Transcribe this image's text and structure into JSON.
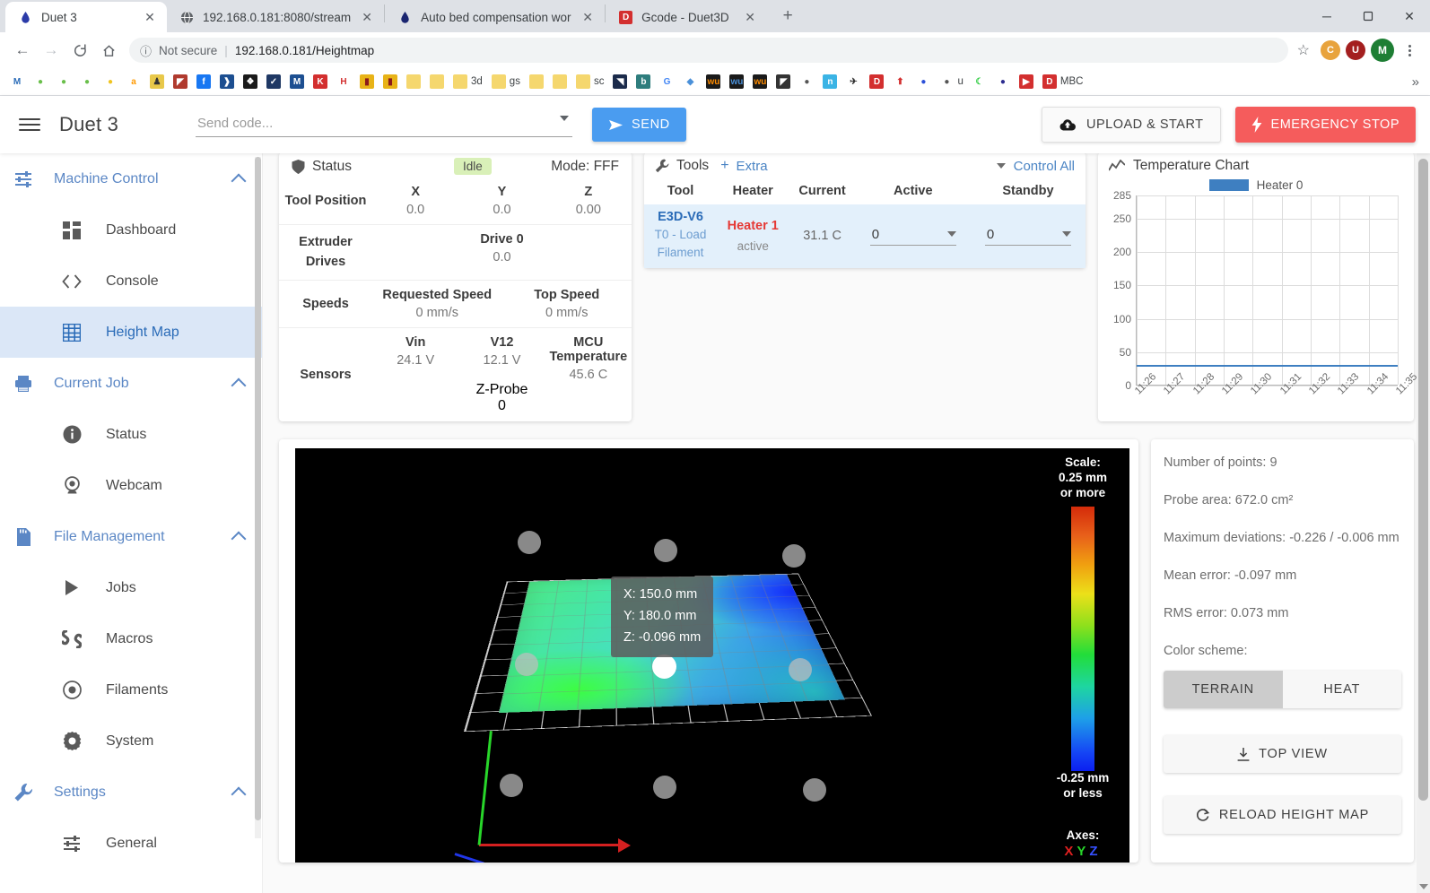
{
  "browser": {
    "tabs": [
      {
        "title": "Duet 3",
        "favicon": "duet-droplet-icon",
        "active": true
      },
      {
        "title": "192.168.0.181:8080/stream",
        "favicon": "globe-icon",
        "active": false
      },
      {
        "title": "Auto bed compensation working",
        "favicon": "duet-droplet-icon",
        "active": false
      },
      {
        "title": "Gcode - Duet3D",
        "favicon": "duet3d-d-icon",
        "active": false
      }
    ],
    "tab_close_label": "✕",
    "new_tab_label": "+",
    "window_controls": {
      "minimize": "─",
      "maximize": "☐",
      "close": "✕"
    },
    "nav": {
      "back": "←",
      "forward": "→",
      "reload": "⟳",
      "home": "⌂"
    },
    "address": {
      "security_label": "Not secure",
      "separator": "|",
      "url": "192.168.0.181/Heightmap"
    },
    "toolbar_right": {
      "bookmark_star": "☆",
      "profile_initial": "M",
      "menu": "kebab-menu-icon"
    },
    "bookmarks": [
      {
        "label": "",
        "icon": "M",
        "color": "#ffffff",
        "fg": "#2b6cb8"
      },
      {
        "label": "",
        "icon": "●",
        "color": "#ffffff",
        "fg": "#6abf4b"
      },
      {
        "label": "",
        "icon": "●",
        "color": "#ffffff",
        "fg": "#6abf4b"
      },
      {
        "label": "",
        "icon": "●",
        "color": "#ffffff",
        "fg": "#6abf4b"
      },
      {
        "label": "",
        "icon": "●",
        "color": "#ffffff",
        "fg": "#f0c420"
      },
      {
        "label": "",
        "icon": "a",
        "color": "#ffffff",
        "fg": "#ff9900"
      },
      {
        "label": "",
        "icon": "♟",
        "color": "#e8c84a",
        "fg": "#333333"
      },
      {
        "label": "",
        "icon": "◤",
        "color": "#b03a2e",
        "fg": "#ffffff"
      },
      {
        "label": "",
        "icon": "f",
        "color": "#1877f2",
        "fg": "#ffffff"
      },
      {
        "label": "",
        "icon": "❱",
        "color": "#1d4f91",
        "fg": "#ffffff"
      },
      {
        "label": "",
        "icon": "❖",
        "color": "#1a1a1a",
        "fg": "#ffffff"
      },
      {
        "label": "",
        "icon": "✓",
        "color": "#1f3864",
        "fg": "#ffffff"
      },
      {
        "label": "",
        "icon": "M",
        "color": "#1d4f91",
        "fg": "#ffffff"
      },
      {
        "label": "",
        "icon": "K",
        "color": "#d32f2f",
        "fg": "#ffffff"
      },
      {
        "label": "",
        "icon": "H",
        "color": "#ffffff",
        "fg": "#d32f2f"
      },
      {
        "label": "",
        "icon": "▮",
        "color": "#e8b317",
        "fg": "#8b1a1a"
      },
      {
        "label": "",
        "icon": "▮",
        "color": "#e8b317",
        "fg": "#8b1a1a"
      },
      {
        "label": "",
        "icon": "",
        "color": "#f5d76e",
        "fg": "#333333"
      },
      {
        "label": "",
        "icon": "",
        "color": "#f5d76e",
        "fg": "#333333"
      },
      {
        "label": "3d",
        "icon": "",
        "color": "#f5d76e",
        "fg": "#333333"
      },
      {
        "label": "gs",
        "icon": "",
        "color": "#f5d76e",
        "fg": "#333333"
      },
      {
        "label": "",
        "icon": "",
        "color": "#f5d76e",
        "fg": "#333333"
      },
      {
        "label": "",
        "icon": "",
        "color": "#f5d76e",
        "fg": "#333333"
      },
      {
        "label": "sc",
        "icon": "",
        "color": "#f5d76e",
        "fg": "#333333"
      },
      {
        "label": "",
        "icon": "◥",
        "color": "#1b2b4b",
        "fg": "#ffffff"
      },
      {
        "label": "",
        "icon": "b",
        "color": "#2e7d7d",
        "fg": "#ffffff"
      },
      {
        "label": "",
        "icon": "G",
        "color": "#ffffff",
        "fg": "#4285f4"
      },
      {
        "label": "",
        "icon": "◆",
        "color": "#ffffff",
        "fg": "#4a90d9"
      },
      {
        "label": "",
        "icon": "wu",
        "color": "#1a1a1a",
        "fg": "#ff8c00"
      },
      {
        "label": "",
        "icon": "wu",
        "color": "#1a1a1a",
        "fg": "#4a90d9"
      },
      {
        "label": "",
        "icon": "wu",
        "color": "#1a1a1a",
        "fg": "#ff8c00"
      },
      {
        "label": "",
        "icon": "◤",
        "color": "#333333",
        "fg": "#ffffff"
      },
      {
        "label": "",
        "icon": "●",
        "color": "#ffffff",
        "fg": "#555555"
      },
      {
        "label": "",
        "icon": "n",
        "color": "#3bb4e5",
        "fg": "#ffffff"
      },
      {
        "label": "",
        "icon": "✈",
        "color": "#ffffff",
        "fg": "#333333"
      },
      {
        "label": "",
        "icon": "D",
        "color": "#d32f2f",
        "fg": "#ffffff"
      },
      {
        "label": "",
        "icon": "⬆",
        "color": "#ffffff",
        "fg": "#d32f2f"
      },
      {
        "label": "",
        "icon": "●",
        "color": "#ffffff",
        "fg": "#2b4fd8"
      },
      {
        "label": "u",
        "icon": "●",
        "color": "#ffffff",
        "fg": "#555555"
      },
      {
        "label": "",
        "icon": "☾",
        "color": "#ffffff",
        "fg": "#2ecc40"
      },
      {
        "label": "",
        "icon": "●",
        "color": "#ffffff",
        "fg": "#2b2b8f"
      },
      {
        "label": "",
        "icon": "▶",
        "color": "#d32f2f",
        "fg": "#ffffff"
      },
      {
        "label": "MBC",
        "icon": "D",
        "color": "#d32f2f",
        "fg": "#ffffff"
      }
    ],
    "bookmarks_overflow": "»"
  },
  "app": {
    "title": "Duet 3",
    "menu_icon": "hamburger-menu-icon",
    "send_code": {
      "placeholder": "Send code...",
      "value": ""
    },
    "send_button": "SEND",
    "upload_button": "UPLOAD & START",
    "emergency_button": "EMERGENCY STOP"
  },
  "sidebar": {
    "groups": [
      {
        "label": "Machine Control",
        "icon": "sliders-icon",
        "items": [
          {
            "label": "Dashboard",
            "icon": "dashboard-icon",
            "active": false
          },
          {
            "label": "Console",
            "icon": "code-brackets-icon",
            "active": false
          },
          {
            "label": "Height Map",
            "icon": "grid-icon",
            "active": true
          }
        ]
      },
      {
        "label": "Current Job",
        "icon": "printer-icon",
        "items": [
          {
            "label": "Status",
            "icon": "info-icon",
            "active": false
          },
          {
            "label": "Webcam",
            "icon": "webcam-icon",
            "active": false
          }
        ]
      },
      {
        "label": "File Management",
        "icon": "sdcard-icon",
        "items": [
          {
            "label": "Jobs",
            "icon": "play-icon",
            "active": false
          },
          {
            "label": "Macros",
            "icon": "macros-icon",
            "active": false
          },
          {
            "label": "Filaments",
            "icon": "filament-icon",
            "active": false
          },
          {
            "label": "System",
            "icon": "gear-icon",
            "active": false
          }
        ]
      },
      {
        "label": "Settings",
        "icon": "wrench-icon",
        "items": [
          {
            "label": "General",
            "icon": "sliders-icon",
            "active": false
          }
        ]
      }
    ]
  },
  "status_panel": {
    "title": "Status",
    "icon": "shield-icon",
    "state_badge": "Idle",
    "mode": "Mode: FFF",
    "rows": [
      {
        "label": "Tool Position",
        "columns": [
          {
            "header": "X",
            "value": "0.0"
          },
          {
            "header": "Y",
            "value": "0.0"
          },
          {
            "header": "Z",
            "value": "0.00"
          }
        ]
      },
      {
        "label": "Extruder Drives",
        "columns": [
          {
            "header": "Drive 0",
            "value": "0.0"
          }
        ]
      },
      {
        "label": "Speeds",
        "columns": [
          {
            "header": "Requested Speed",
            "value": "0 mm/s"
          },
          {
            "header": "Top Speed",
            "value": "0 mm/s"
          }
        ]
      },
      {
        "label": "Sensors",
        "columns": [
          {
            "header": "Vin",
            "value": "24.1 V"
          },
          {
            "header": "V12",
            "value": "12.1 V"
          },
          {
            "header": "MCU Temperature",
            "value": "45.6 C"
          }
        ],
        "sub": {
          "header": "Z-Probe",
          "value": "0"
        }
      }
    ]
  },
  "tools_panel": {
    "title": "Tools",
    "icon": "wrench-icon",
    "add_label": "Extra",
    "add_symbol": "+",
    "control_all": "Control All",
    "headers": [
      "Tool",
      "Heater",
      "Current",
      "Active",
      "Standby"
    ],
    "rows": [
      {
        "tool_name": "E3D-V6",
        "tool_sub": "T0 - Load Filament",
        "heater": "Heater 1",
        "heater_state": "active",
        "current": "31.1 C",
        "active_value": "0",
        "standby_value": "0"
      }
    ]
  },
  "chart_data": {
    "type": "line",
    "title": "Temperature Chart",
    "icon": "chart-line-icon",
    "legend": [
      {
        "name": "Heater 0",
        "color": "#3e7fc1"
      }
    ],
    "legend_position": "top",
    "grid": true,
    "ylabel": "",
    "xlabel": "",
    "ylim": [
      0,
      285
    ],
    "yticks": [
      0,
      50,
      100,
      150,
      200,
      250,
      285
    ],
    "x": [
      "11:26",
      "11:27",
      "11:28",
      "11:29",
      "11:30",
      "11:31",
      "11:32",
      "11:33",
      "11:34",
      "11:35"
    ],
    "series": [
      {
        "name": "Heater 0",
        "color": "#3e7fc1",
        "values": [
          31.2,
          31.2,
          31.1,
          31.1,
          31.1,
          31.1,
          31.1,
          31.1,
          31.1,
          31.1
        ]
      }
    ]
  },
  "heightmap": {
    "tooltip": {
      "x": "X: 150.0 mm",
      "y": "Y: 180.0 mm",
      "z": "Z: -0.096 mm"
    },
    "scale": {
      "title": "Scale:",
      "max_label": "0.25 mm\nor more",
      "max_line1": "0.25 mm",
      "max_line2": "or more",
      "min_line1": "-0.25 mm",
      "min_line2": "or less"
    },
    "axes": {
      "title": "Axes:",
      "x": "X",
      "y": "Y",
      "z": "Z",
      "x_color": "#e02020",
      "y_color": "#28d62a",
      "z_color": "#3550ff"
    },
    "stats": [
      "Number of points: 9",
      "Probe area: 672.0 cm²",
      "Maximum deviations: -0.226 / -0.006 mm",
      "Mean error: -0.097 mm",
      "RMS error: 0.073 mm"
    ],
    "color_scheme_label": "Color scheme:",
    "schemes": [
      {
        "label": "TERRAIN",
        "selected": true
      },
      {
        "label": "HEAT",
        "selected": false
      }
    ],
    "top_view_button": "TOP VIEW",
    "top_view_icon": "download-arrow-icon",
    "reload_button": "RELOAD HEIGHT MAP",
    "reload_icon": "refresh-icon"
  }
}
